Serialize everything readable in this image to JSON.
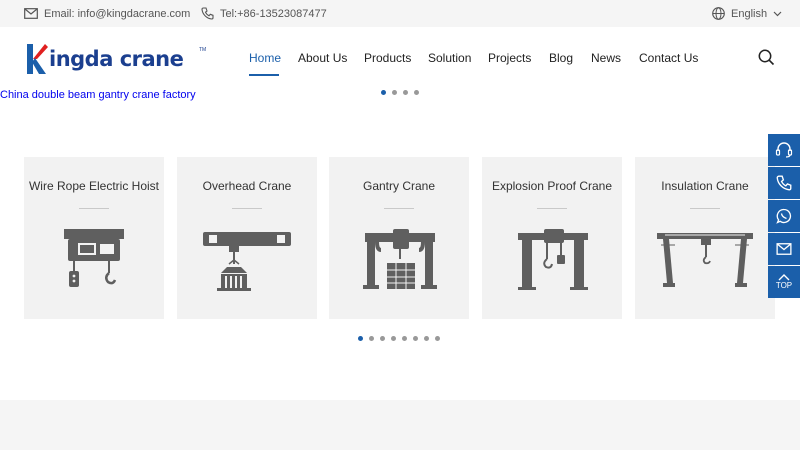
{
  "topbar": {
    "email": "Email: info@kingdacrane.com",
    "tel": "Tel:+86-13523087477",
    "language": "English"
  },
  "logo": {
    "text": "ingda crane",
    "tm": "TM"
  },
  "nav": {
    "items": [
      {
        "label": "Home",
        "active": true
      },
      {
        "label": "About Us"
      },
      {
        "label": "Products"
      },
      {
        "label": "Solution"
      },
      {
        "label": "Projects"
      },
      {
        "label": "Blog"
      },
      {
        "label": "News"
      },
      {
        "label": "Contact Us"
      }
    ]
  },
  "banner": {
    "alt_text": "China double beam gantry crane factory",
    "dot_count": 4,
    "active_dot": 0
  },
  "products": {
    "cards": [
      {
        "title": "Wire Rope Electric Hoist",
        "icon": "electric-hoist-icon"
      },
      {
        "title": "Overhead Crane",
        "icon": "overhead-crane-icon"
      },
      {
        "title": "Gantry Crane",
        "icon": "gantry-crane-icon"
      },
      {
        "title": "Explosion Proof Crane",
        "icon": "explosion-proof-crane-icon"
      },
      {
        "title": "Insulation Crane",
        "icon": "insulation-crane-icon"
      }
    ],
    "dot_count": 8,
    "active_dot": 0
  },
  "sidebar": {
    "items": [
      {
        "icon": "customer-service-icon"
      },
      {
        "icon": "phone-icon"
      },
      {
        "icon": "whatsapp-icon"
      },
      {
        "icon": "mail-icon"
      },
      {
        "icon": "back-to-top-icon",
        "label": "TOP"
      }
    ]
  },
  "colors": {
    "brand": "#1b5faa",
    "logo": "#1b3f8f",
    "card_bg": "#f2f2f2",
    "illustration": "#5f5f5f"
  }
}
